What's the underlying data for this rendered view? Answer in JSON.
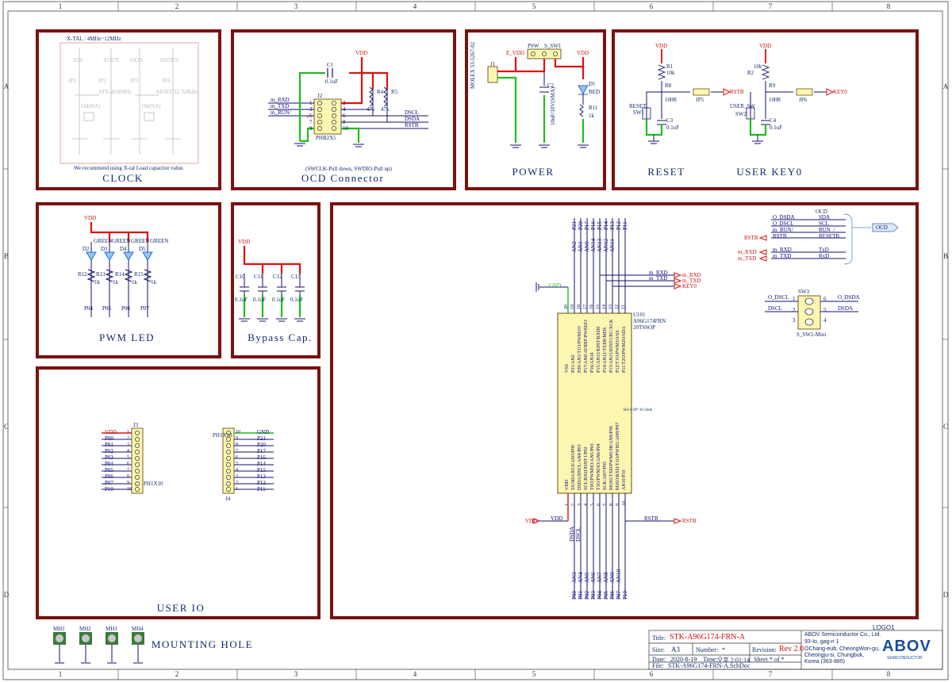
{
  "zones": {
    "cols": [
      "1",
      "2",
      "3",
      "4",
      "5",
      "6",
      "7",
      "8"
    ],
    "rows": [
      "A",
      "B",
      "C",
      "D"
    ]
  },
  "blocks": {
    "clock": {
      "title": "CLOCK",
      "header": "X-TAL : 4MHz~12MHz",
      "note": "We recommend using X-tal Load capacitor value.",
      "parts": [
        "JP1",
        "JP2",
        "JP3",
        "JP4",
        "1M(NA)",
        "1M(NA)",
        "ATS-49/8MHz",
        "AB38T-32.768kHz",
        "XIN",
        "XOUT",
        "SXIN",
        "SXOUT"
      ]
    },
    "ocd": {
      "title": "OCD Connector",
      "note": "(SWCLK-Pull down, SWDIO-Pull up)",
      "ref": "J2",
      "part": "PHB2X5",
      "cap": "C1",
      "cap_value": "0.1uF",
      "r4": "R4",
      "r5": "R5",
      "r_value": "47k",
      "vdd": "VDD",
      "nets_in": [
        "m_RXD",
        "m_TXD",
        "m_RUN/"
      ],
      "nets_out": [
        "DSCL",
        "DSDA",
        "RSTB"
      ],
      "pins_left": [
        "1",
        "3",
        "5",
        "7",
        "9"
      ],
      "pins_right": [
        "2",
        "4",
        "6",
        "8",
        "10"
      ]
    },
    "power": {
      "title": "POWER",
      "j1": "J1",
      "j1_part": "MOLEX 53-5267-02",
      "evdd": "E_VDD",
      "psw": "PSW",
      "ssw": "S_SW1",
      "c2": "C2",
      "c2_value": "10uF/10V(SMA)",
      "d1": "D1",
      "d1_label": "RED",
      "r11": "R11",
      "r11_value": "1k",
      "vdd": "VDD"
    },
    "reset": {
      "title": "RESET",
      "vdd": "VDD",
      "r1": "R1",
      "r1_value": "10k",
      "r8": "R8",
      "r8_value": "100R",
      "jp": "JP5",
      "sw": "SW1",
      "sw_label": "RESET",
      "cap": "C3",
      "cap_value": "0.1uF",
      "net": "RSTB"
    },
    "key": {
      "title": "USER KEY0",
      "vdd": "VDD",
      "r2": "R2",
      "r2_value": "10k",
      "r9": "R9",
      "r9_value": "100R",
      "jp": "JP6",
      "sw": "SW2",
      "sw_label": "USER_SW",
      "cap": "C4",
      "cap_value": "0.1uF",
      "net": "KEY0"
    },
    "pwm": {
      "title": "PWM LED",
      "vdd": "VDD",
      "leds": [
        "D2",
        "D3",
        "D4",
        "D5"
      ],
      "led_color": "GREEN",
      "res": [
        "R12",
        "R13",
        "R14",
        "R15"
      ],
      "res_value": "1k",
      "nets": [
        "P04",
        "P05",
        "P06",
        "P07"
      ]
    },
    "bypass": {
      "title": "Bypass Cap.",
      "vdd": "VDD",
      "caps": [
        "C10",
        "C11",
        "C12",
        "C13"
      ],
      "cap_value": "0.1uF"
    },
    "userio": {
      "title": "USER IO",
      "j3": "J3",
      "j3_part": "PH1X10",
      "j3_nets": [
        "VDD",
        "P00",
        "P01",
        "P02",
        "P03",
        "P04",
        "P05",
        "P06",
        "P07",
        "P10"
      ],
      "j3_pins": [
        "1",
        "2",
        "3",
        "4",
        "5",
        "6",
        "7",
        "8",
        "9",
        "10"
      ],
      "j4": "J4",
      "j4_part": "PH1X10",
      "j4_nets": [
        "GND",
        "P21",
        "P20",
        "P17",
        "P16",
        "P14",
        "P15",
        "P13",
        "P12",
        "P11"
      ],
      "j4_pins": [
        "10",
        "9",
        "8",
        "7",
        "6",
        "5",
        "4",
        "3",
        "2",
        "1"
      ]
    },
    "mcu": {
      "ref": "U101",
      "part": "A96G174FRN",
      "package": "20TSSOP",
      "top_nets": [
        "AN2",
        "AN1",
        "AN0",
        "AN14",
        "AN13",
        "AN12",
        "AN11"
      ],
      "top_ports": [
        "P21",
        "P20",
        "P17",
        "P16",
        "P15",
        "P14",
        "P13",
        "P12",
        "P11"
      ],
      "top_pins": [
        "20",
        "19",
        "18",
        "17",
        "16",
        "15",
        "14",
        "13",
        "12",
        "11"
      ],
      "pins_top_desc": [
        "VSS",
        "P21/AN2",
        "P20/AN1/T1O/PWM1O",
        "P17/AN0/AVREF/PWM2O",
        "P16/AN14",
        "P15/AN13/EINT/RXD0",
        "P14/AN12/TXD0/MDS",
        "P13/AN11/EINT1/EC/XCK",
        "P12/T1O/PWM1O/SS",
        "P11/T2O/PWM2O/SDA"
      ],
      "pins_bot_desc": [
        "VDD",
        "SS/SDA/EC0/AN3/P00",
        "DSDA/DSCL/AN4/P01",
        "SCL/RXD/EINT1/P02",
        "T0O/PWM0O/AN5/P03",
        "T3O/PWM3O/AN6/P04",
        "SCK/AN7/P05",
        "MOSI/TXD/PWM0.0B/AN8/P06",
        "MISO/RXD/T1O/PWM1/AN9/P07",
        "AN10/P10"
      ],
      "bot_pins": [
        "1",
        "2",
        "3",
        "4",
        "5",
        "6",
        "7",
        "8",
        "9",
        "10"
      ],
      "bot_nets": [
        "AN3",
        "AN4",
        "AN5",
        "AN6",
        "AN7",
        "AN8",
        "AN9",
        "AN10"
      ],
      "bot_ports": [
        "P00",
        "P01",
        "P02",
        "P03",
        "P04",
        "P05",
        "P06",
        "P07",
        "P10"
      ],
      "dsda": "DSDA",
      "dscl": "DSCL",
      "gnd": "GND",
      "vdd": "VDD",
      "rstb": "RSTB",
      "mrxd": "m_RXD",
      "mtxd": "m_TXD",
      "key0": "KEY0",
      "note": "Bit-1 SP=10.3mm"
    },
    "ocd_bus": {
      "label": "OCD",
      "left": [
        "O_DSDA",
        "O_DSCL",
        "m_RUN/",
        "RSTB",
        "m_RXD",
        "m_TXD"
      ],
      "right": [
        "SDA",
        "SCL",
        "RUN_/",
        "RESETB",
        "TxD",
        "RxD"
      ],
      "rstb": "RSTB",
      "m_rxd": "m_RXD",
      "m_txd": "m_TXD"
    },
    "sw3": {
      "ref": "SW3",
      "part": "S_SW2-Mini",
      "left_nets": [
        "O_DSCL",
        "DSCL"
      ],
      "right_nets": [
        "O_DSDA",
        "DSDA"
      ],
      "pins": [
        "1",
        "6",
        "2",
        "5",
        "3",
        "4"
      ]
    },
    "mounting": {
      "title": "MOUNTING HOLE",
      "holes": [
        "MH1",
        "MH2",
        "MH3",
        "MH4"
      ]
    }
  },
  "title_block": {
    "title_label": "Title:",
    "title": "STK-A96G174-FRN-A",
    "size_label": "Size:",
    "size": "A3",
    "number_label": "Number:",
    "number": "*",
    "revision_label": "Revision:",
    "revision": "Rev 2.0",
    "date_label": "Date:",
    "date": "2020-8-19",
    "time_label": "Time:",
    "time": "오후 2:01:14",
    "sheet_label": "Sheet",
    "sheet": "* of *",
    "file_label": "File:",
    "file": "STK-A96G174-FRN-A.SchDoc",
    "company": [
      "ABOV Semiconductor Co., Ltd.",
      "93-Io, gag-ri 1",
      "OChang-eub, CheongWon-gu,",
      "Cheongju-si, Chungbuk,",
      "Korea (363-885)"
    ],
    "logo_ref": "LOGO1",
    "logo": "ABOV",
    "logo_sub": "SEMICONDUCTOR"
  },
  "colors": {
    "frame": "#7a1111",
    "wire": "#10106e",
    "power": "#dd1111",
    "gnd": "#22bb22",
    "body": "#fbf6b0"
  }
}
